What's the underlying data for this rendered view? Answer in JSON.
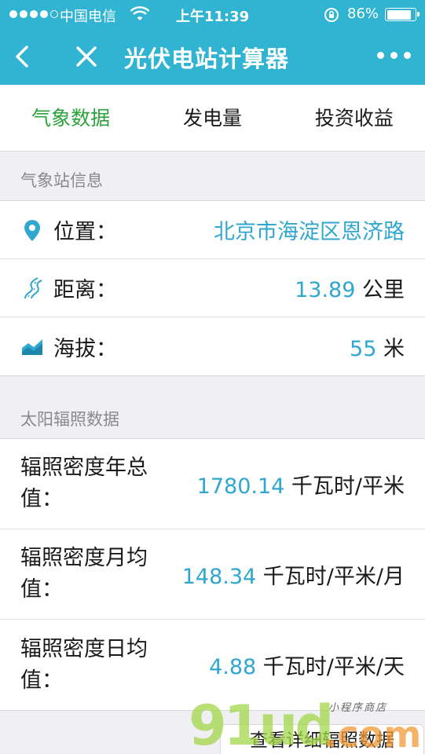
{
  "status_bar": {
    "carrier": "中国电信",
    "time": "上午11:39",
    "battery_pct": "86%"
  },
  "nav": {
    "title": "光伏电站计算器"
  },
  "tabs": [
    {
      "label": "气象数据",
      "active": true
    },
    {
      "label": "发电量",
      "active": false
    },
    {
      "label": "投资收益",
      "active": false
    }
  ],
  "station": {
    "heading": "气象站信息",
    "location_label": "位置：",
    "location_value": "北京市海淀区恩济路",
    "distance_label": "距离：",
    "distance_value": "13.89",
    "distance_unit": " 公里",
    "altitude_label": "海拔：",
    "altitude_value": "55",
    "altitude_unit": " 米"
  },
  "radiation": {
    "heading": "太阳辐照数据",
    "rows": [
      {
        "label": "辐照密度年总值：",
        "value": "1780.14",
        "unit": " 千瓦时/平米"
      },
      {
        "label": "辐照密度月均值：",
        "value": "148.34",
        "unit": " 千瓦时/平米/月"
      },
      {
        "label": "辐照密度日均值：",
        "value": "4.88",
        "unit": " 千瓦时/平米/天"
      }
    ]
  },
  "footer": {
    "detail_link": "查看详细辐照数据"
  },
  "watermark": {
    "brand": "91ud",
    "suffix": ".com",
    "tagline": "小程序商店"
  },
  "colors": {
    "header": "#30b4d2",
    "active_tab": "#2aa33a",
    "value_blue": "#2fa7cf"
  }
}
